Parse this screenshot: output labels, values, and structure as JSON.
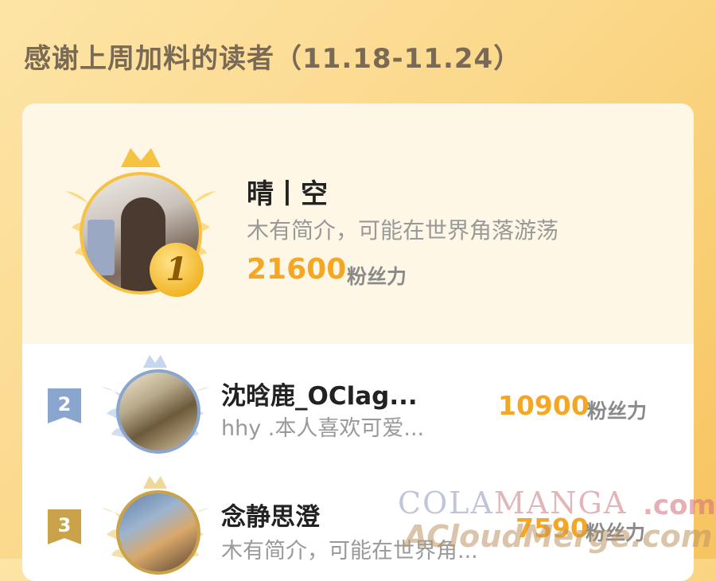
{
  "header": {
    "title": "感谢上周加料的读者（11.18-11.24）"
  },
  "top_reader": {
    "rank": "1",
    "name": "晴丨空",
    "bio": "木有简介，可能在世界角落游荡",
    "score": "21600",
    "unit": "粉丝力"
  },
  "readers": [
    {
      "rank": "2",
      "name": "沈晗鹿_OClag...",
      "bio": "hhy .本人喜欢可爱...",
      "score": "10900",
      "unit": "粉丝力"
    },
    {
      "rank": "3",
      "name": "念静思澄",
      "bio": "木有简介，可能在世界角...",
      "score": "7590",
      "unit": "粉丝力"
    }
  ],
  "watermark": {
    "line1_a": "COLA",
    "line1_b": "MANGA",
    "line1_c": ".com",
    "line2": "ACloudMerge.com"
  },
  "colors": {
    "gold": "#f5c242",
    "silver": "#8aa6cf",
    "bronze": "#c9a24a",
    "score": "#f5a623"
  }
}
